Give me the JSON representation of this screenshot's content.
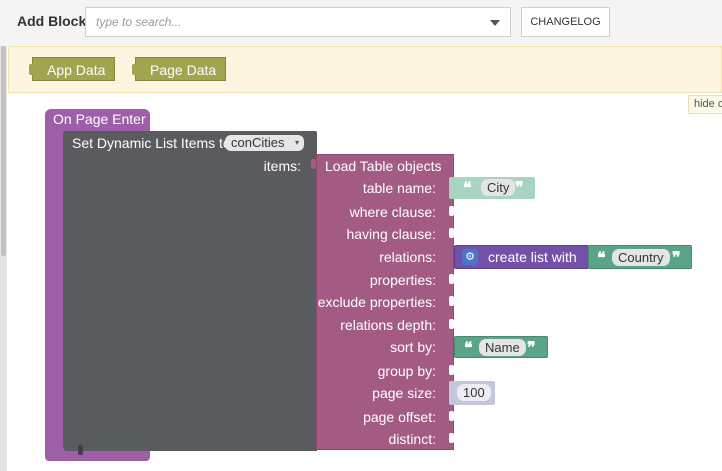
{
  "toolbar": {
    "add_block_label": "Add Block:",
    "search_placeholder": "type to search...",
    "changelog_label": "CHANGELOG"
  },
  "palette": {
    "items": [
      {
        "label": "App Data"
      },
      {
        "label": "Page Data"
      }
    ],
    "hide_label": "hide c"
  },
  "workspace": {
    "event_block": {
      "label": "On Page Enter"
    },
    "set_block": {
      "label": "Set Dynamic List Items to",
      "variable": "conCities",
      "items_label": "items:"
    },
    "load_block": {
      "title": "Load Table objects",
      "fields": [
        {
          "label": "table name:",
          "value": "City"
        },
        {
          "label": "where clause:"
        },
        {
          "label": "having clause:"
        },
        {
          "label": "relations:"
        },
        {
          "label": "properties:"
        },
        {
          "label": "exclude properties:"
        },
        {
          "label": "relations depth:"
        },
        {
          "label": "sort by:",
          "value": "Name"
        },
        {
          "label": "group by:"
        },
        {
          "label": "page size:",
          "value": "100"
        },
        {
          "label": "page offset:"
        },
        {
          "label": "distinct:"
        }
      ]
    },
    "list_block": {
      "label": "create list with",
      "item_value": "Country"
    }
  },
  "colors": {
    "event": "#9d5fa7",
    "set": "#5a5b5f",
    "load": "#a35b84",
    "list": "#7451a8",
    "text": "#5aa587",
    "number": "#c4c7dc",
    "palette_block": "#a2a54f"
  }
}
